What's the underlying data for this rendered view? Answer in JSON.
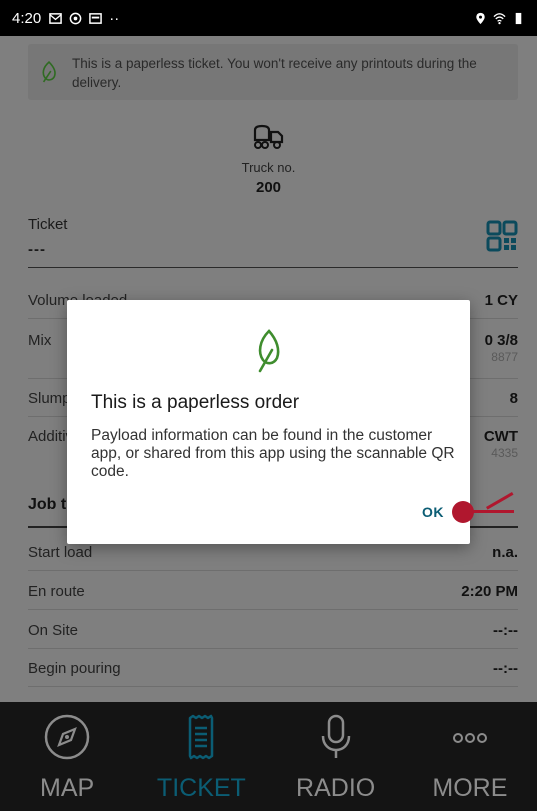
{
  "status_bar": {
    "time": "4:20",
    "icons_left": [
      "gmail-icon",
      "sync-icon",
      "notification-icon",
      "more-dots-icon"
    ],
    "icons_right": [
      "location-icon",
      "wifi-icon",
      "battery-icon"
    ],
    "more": "··"
  },
  "banner": {
    "text": "This is a paperless ticket. You won't receive any printouts during the delivery."
  },
  "truck": {
    "label": "Truck no.",
    "number": "200"
  },
  "ticket": {
    "label": "Ticket",
    "value": "---"
  },
  "details": {
    "volume": {
      "label": "Volume loaded",
      "value": "1 CY"
    },
    "mix": {
      "label": "Mix",
      "value": "0 3/8",
      "sub": "8877"
    },
    "slump": {
      "label": "Slump",
      "value": "8"
    },
    "additives": {
      "label": "Additives",
      "value": "CWT",
      "sub": "4335"
    }
  },
  "job_times": {
    "title": "Job times",
    "rows": [
      {
        "label": "Start load",
        "value": "n.a."
      },
      {
        "label": "En route",
        "value": "2:20 PM"
      },
      {
        "label": "On Site",
        "value": "--:--"
      },
      {
        "label": "Begin pouring",
        "value": "--:--"
      }
    ]
  },
  "dialog": {
    "title": "This is a paperless order",
    "body": "Payload information can be found in the customer app, or shared from this app using the scannable QR code.",
    "ok": "OK"
  },
  "nav": [
    {
      "label": "MAP",
      "icon": "compass-icon",
      "active": false
    },
    {
      "label": "TICKET",
      "icon": "receipt-icon",
      "active": true
    },
    {
      "label": "RADIO",
      "icon": "microphone-icon",
      "active": false
    },
    {
      "label": "MORE",
      "icon": "more-icon",
      "active": false
    }
  ],
  "colors": {
    "accent": "#0b5d74",
    "leaf": "#3f8d2e",
    "pointer": "#b0172e",
    "overlay": "#7f7f7f",
    "navbar": "#141414"
  }
}
